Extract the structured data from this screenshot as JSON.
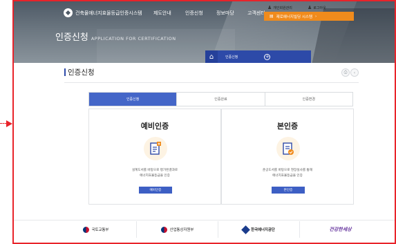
{
  "header": {
    "site_name": "건축물에너지효율등급인증시스템",
    "gnb": [
      "제도안내",
      "인증신청",
      "정보마당",
      "고객센터"
    ],
    "util": [
      {
        "icon": "person-icon",
        "label": "개인회원관리"
      },
      {
        "icon": "person-icon",
        "label": "로그아웃"
      }
    ],
    "zero_button": "제로에너지빌딩 시스템",
    "page_title": "인증신청",
    "page_title_en": "APPLICATION FOR CERTIFICATION",
    "location": {
      "home_icon": "home-icon",
      "current": "인증신청",
      "plus": "+"
    }
  },
  "main": {
    "title": "인증신청",
    "tool_buttons": [
      "print-icon",
      "share-icon"
    ],
    "tabs": [
      {
        "label": "인증신청",
        "active": true
      },
      {
        "label": "인증완료",
        "active": false
      },
      {
        "label": "인증변경",
        "active": false
      }
    ],
    "panels": [
      {
        "title": "예비인증",
        "icon": "document-pencil-icon",
        "desc1": "설계도서를 바탕으로 평가된결과로",
        "desc2": "에너지효율등급을 인증",
        "button": "예비인증"
      },
      {
        "title": "본인증",
        "icon": "document-check-icon",
        "desc1": "준공도서를 바탕으로 현장실사를 통해",
        "desc2": "에너지효율등급을 인증",
        "button": "본인증"
      }
    ]
  },
  "footer": {
    "links": [
      {
        "label": "국토교통부"
      },
      {
        "label": "산업통상자원부"
      },
      {
        "label": "한국에너지공단"
      },
      {
        "label": "건강한세상"
      }
    ]
  },
  "colors": {
    "accent": "#2d4aa8",
    "tab_active": "#4466c8",
    "orange": "#f08b1c",
    "highlight": "#e8232a"
  }
}
